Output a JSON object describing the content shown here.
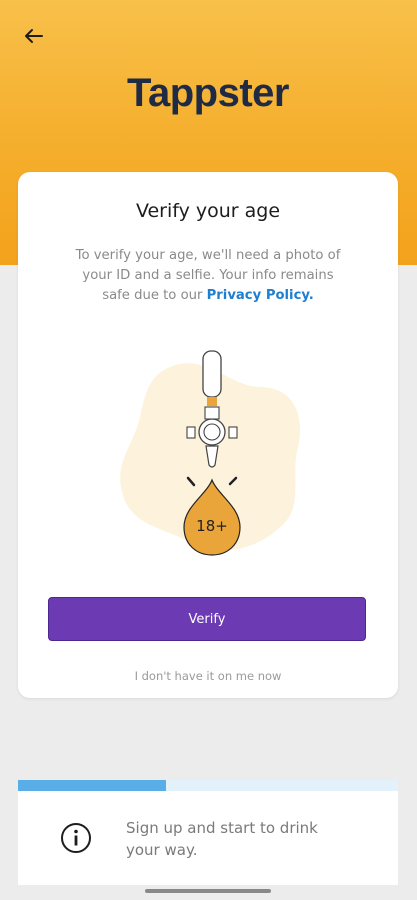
{
  "header": {
    "back_icon": "arrow-left-icon",
    "logo_text": "Tappster"
  },
  "card": {
    "title": "Verify your age",
    "description": "To verify your age, we'll need a photo of your ID and a selfie.  Your info remains safe due to our",
    "policy_link": "Privacy Policy.",
    "badge_text": "18+",
    "verify_button": "Verify",
    "alt_link": "I don't have it on me now"
  },
  "bottom": {
    "info_icon": "info-icon",
    "text": "Sign up and start to drink your way.",
    "progress": 0.39
  },
  "colors": {
    "header_top": "#f8c04a",
    "header_bottom": "#f3a21c",
    "brand_navy": "#1f2a44",
    "button_purple": "#6c3ab3",
    "link_blue": "#1e7fd0",
    "progress_blue": "#5aaee8",
    "drop_orange": "#e9a43a",
    "blob_cream": "#fdf3dd"
  }
}
